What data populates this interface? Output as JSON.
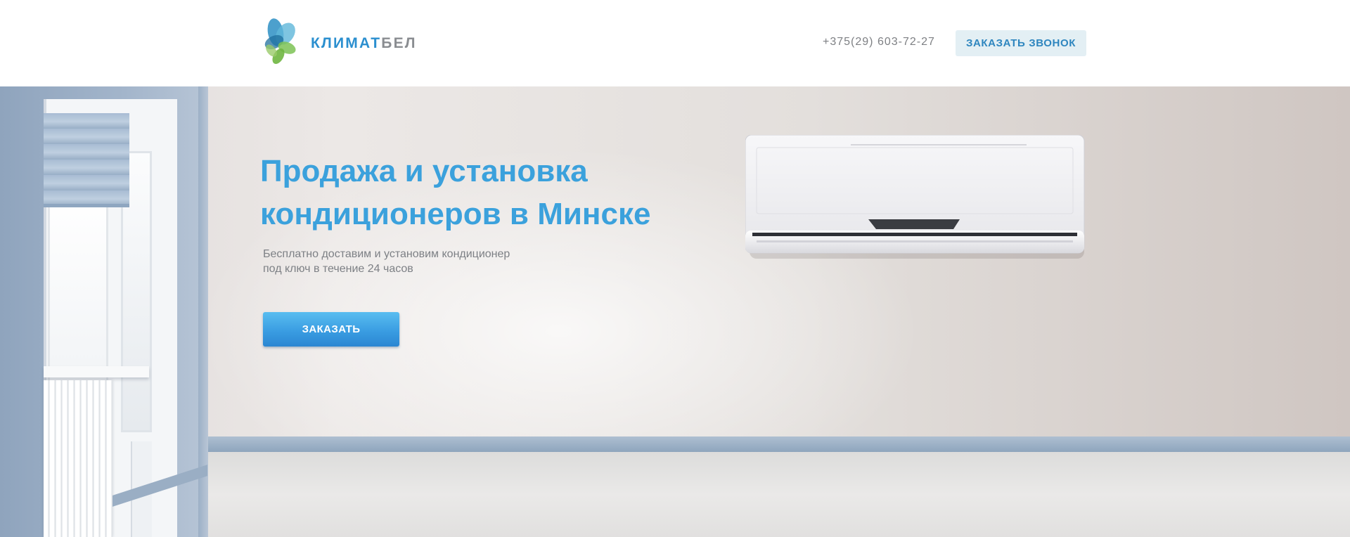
{
  "header": {
    "logo": {
      "part1": "КЛИМАТ",
      "part2": "БЕЛ",
      "icon": "leaf-logo-icon",
      "colors": {
        "part1": "#2b8fcf",
        "part2": "#8a8d91"
      }
    },
    "phone": "+375(29) 603-72-27",
    "callback_button_label": "ЗАКАЗАТЬ ЗВОНОК"
  },
  "hero": {
    "title_line1": "Продажа и установка",
    "title_line2": "кондиционеров в Минске",
    "subtitle_line1": "Бесплатно доставим и установим кондиционер",
    "subtitle_line2": "под ключ в течение 24 часов",
    "order_button_label": "ЗАКАЗАТЬ",
    "illustration": "air-conditioner-icon",
    "colors": {
      "accent": "#3ba1dc",
      "button": "#3a9de2"
    }
  }
}
